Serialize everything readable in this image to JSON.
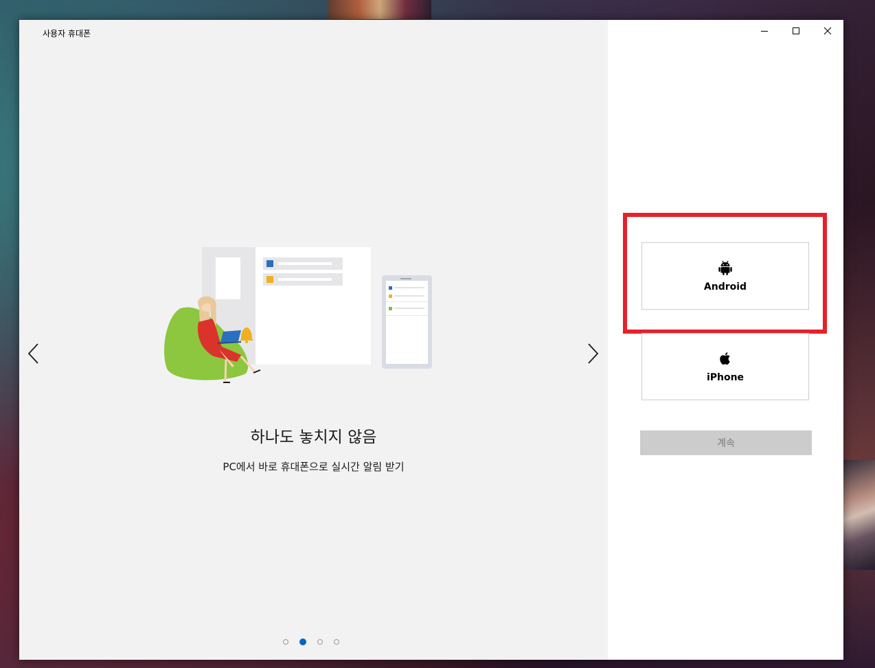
{
  "window": {
    "title": "사용자 휴대폰"
  },
  "slide": {
    "heading": "하나도 놓치지 않음",
    "subtitle": "PC에서 바로 휴대폰으로 실시간 알림 받기",
    "total": 4,
    "active_index": 1
  },
  "icons": {
    "prev": "chevron-left-icon",
    "next": "chevron-right-icon",
    "android": "android-icon",
    "iphone": "apple-icon",
    "minimize": "minimize-icon",
    "maximize": "maximize-icon",
    "close": "close-icon"
  },
  "choices": {
    "android_label": "Android",
    "iphone_label": "iPhone"
  },
  "actions": {
    "continue_label": "계속"
  },
  "colors": {
    "accent": "#0067c0",
    "highlight": "#e8202a",
    "disabled_button": "#cccccc"
  }
}
